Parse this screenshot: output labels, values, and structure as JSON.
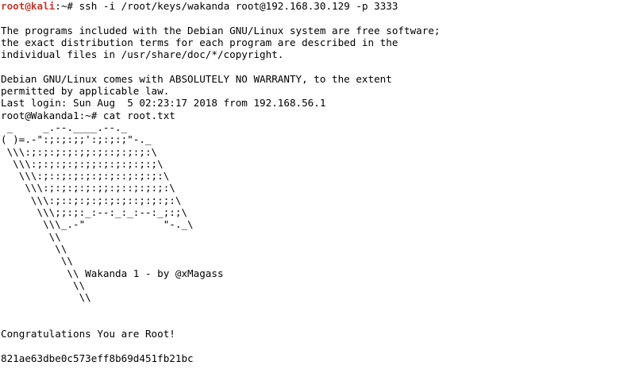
{
  "terminal": {
    "first_prompt": {
      "user_host": "root@kali",
      "sep": ":~# ",
      "command": "ssh -i /root/keys/wakanda root@192.168.30.129 -p 3333"
    },
    "lines": [
      "",
      "The programs included with the Debian GNU/Linux system are free software;",
      "the exact distribution terms for each program are described in the",
      "individual files in /usr/share/doc/*/copyright.",
      "",
      "Debian GNU/Linux comes with ABSOLUTELY NO WARRANTY, to the extent",
      "permitted by applicable law.",
      "Last login: Sun Aug  5 02:23:17 2018 from 192.168.56.1",
      "root@Wakanda1:~# cat root.txt",
      " _     _.--.____.--._",
      "( )=.-\":;:;:;;':;:;:;\"-._",
      " \\\\\\:;:;:;:;:;;:;::;:;:;:\\",
      "  \\\\\\:;:;:;:;:;;:;:;:;:;:;\\",
      "   \\\\\\:;::;:;:;:;:;::;:;:;:\\",
      "    \\\\\\:;:;:;:;:;;:;::;:;:;:\\",
      "     \\\\\\:;::;:;:;:;:;::;:;:;:\\",
      "      \\\\\\;;:;:_:--:_:_:--:_;:;\\",
      "       \\\\\\_.-\"             \"-._\\",
      "        \\\\",
      "         \\\\",
      "          \\\\",
      "           \\\\ Wakanda 1 - by @xMagass",
      "            \\\\",
      "             \\\\",
      "",
      "",
      "Congratulations You are Root!",
      "",
      "821ae63dbe0c573eff8b69d451fb21bc"
    ]
  },
  "colors": {
    "prompt_user": "#c0392b",
    "text": "#000000",
    "background": "#ffffff"
  }
}
